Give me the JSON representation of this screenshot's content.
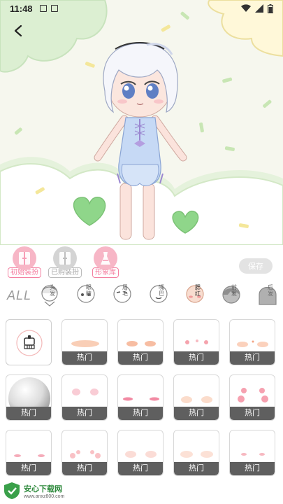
{
  "status_bar": {
    "time": "11:48"
  },
  "mode_tabs": [
    {
      "label": "初始装扮",
      "color": "#f47fa0",
      "active": false
    },
    {
      "label": "已购装扮",
      "color": "#b3b3b3",
      "active": false
    },
    {
      "label": "形象库",
      "color": "#f47fa0",
      "active": true
    }
  ],
  "save_label": "保存",
  "all_label": "ALL",
  "part_tabs": [
    {
      "label": "头发",
      "selected": false
    },
    {
      "label": "眼睛",
      "selected": false
    },
    {
      "label": "眉毛",
      "selected": false
    },
    {
      "label": "嘴巴",
      "selected": false
    },
    {
      "label": "腮红",
      "selected": true
    },
    {
      "label": "前发",
      "selected": false
    },
    {
      "label": "后发",
      "selected": false
    }
  ],
  "grid_tag": "热门",
  "grid_items": [
    {
      "kind": "empty",
      "tag": ""
    },
    {
      "kind": "blush-wide",
      "tag": "热门"
    },
    {
      "kind": "blush-oval",
      "tag": "热门"
    },
    {
      "kind": "blush-dots",
      "tag": "热门"
    },
    {
      "kind": "blush-soft",
      "tag": "热门"
    },
    {
      "kind": "sphere",
      "tag": "热门"
    },
    {
      "kind": "blush-pink",
      "tag": "热门"
    },
    {
      "kind": "blush-line",
      "tag": "热门"
    },
    {
      "kind": "blush-light",
      "tag": "热门"
    },
    {
      "kind": "blush-hearts",
      "tag": "热门"
    },
    {
      "kind": "blush-tiny",
      "tag": "热门"
    },
    {
      "kind": "blush-spots",
      "tag": "热门"
    },
    {
      "kind": "blush-faint",
      "tag": "热门"
    },
    {
      "kind": "blush-peach",
      "tag": "热门"
    },
    {
      "kind": "blush-small",
      "tag": "热门"
    }
  ],
  "watermark": {
    "title": "安心下载网",
    "url": "www.anxz800.com"
  }
}
